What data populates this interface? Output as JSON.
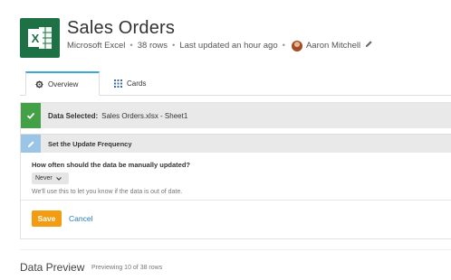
{
  "header": {
    "title": "Sales Orders",
    "app": "Microsoft Excel",
    "rows": "38 rows",
    "updated": "Last updated an hour ago",
    "owner": "Aaron Mitchell",
    "separator": "•",
    "app_icon": "excel-icon",
    "accent": "#1e7145"
  },
  "tabs": [
    {
      "label": "Overview",
      "icon": "gear-icon",
      "active": true
    },
    {
      "label": "Cards",
      "icon": "grid-icon",
      "active": false
    }
  ],
  "steps": {
    "data_selected": {
      "label": "Data Selected:",
      "value": "Sales Orders.xlsx - Sheet1",
      "color": "#43a047"
    },
    "update_frequency": {
      "label": "Set the Update Frequency",
      "question": "How often should the data be manually updated?",
      "selected": "Never",
      "hint": "We'll use this to let you know if the data is out of date.",
      "color": "#9bc5e6"
    }
  },
  "actions": {
    "save": "Save",
    "cancel": "Cancel",
    "save_color": "#f39c12"
  },
  "preview": {
    "title": "Data Preview",
    "subtitle": "Previewing 10 of 38 rows"
  }
}
